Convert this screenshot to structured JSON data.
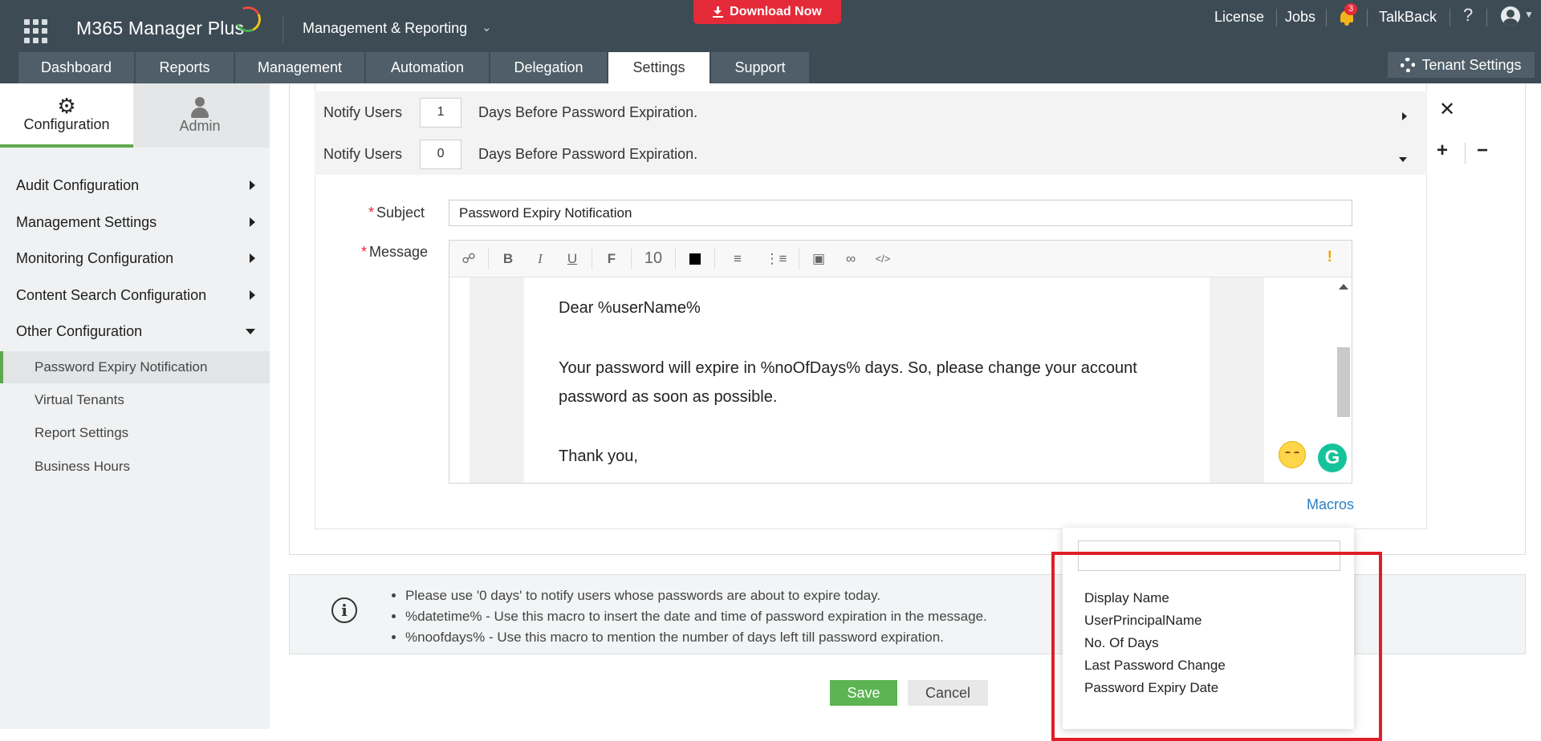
{
  "app": {
    "logo": "M365 Manager Plus",
    "module": "Management & Reporting",
    "download": "Download Now"
  },
  "topnav": {
    "license": "License",
    "jobs": "Jobs",
    "bell_count": "3",
    "talkback": "TalkBack",
    "help": "?"
  },
  "tabs": [
    "Dashboard",
    "Reports",
    "Management",
    "Automation",
    "Delegation",
    "Settings",
    "Support"
  ],
  "tenant_settings": "Tenant Settings",
  "sidebar": {
    "tabs": [
      "Configuration",
      "Admin"
    ],
    "sections": [
      "Audit Configuration",
      "Management Settings",
      "Monitoring Configuration",
      "Content Search Configuration",
      "Other Configuration"
    ],
    "sub_items": [
      "Password Expiry Notification",
      "Virtual Tenants",
      "Report Settings",
      "Business Hours"
    ]
  },
  "notify": [
    {
      "label": "Notify Users",
      "days": "1",
      "text": "Days Before Password Expiration."
    },
    {
      "label": "Notify Users",
      "days": "0",
      "text": "Days Before Password Expiration."
    }
  ],
  "form": {
    "subject_label": "Subject",
    "subject_value": "Password Expiry Notification",
    "message_label": "Message",
    "font_size": "10",
    "font_icon": "F",
    "body": [
      "Dear %userName%",
      "Your password will expire in %noOfDays% days. So, please change your account",
      "password as soon as possible.",
      "Thank you,"
    ],
    "macros": "Macros"
  },
  "info": [
    "Please use '0 days' to notify users whose passwords are about to expire today.",
    "%datetime% - Use this macro to insert the date and time of password expiration in the message.",
    "%noofdays% - Use this macro to mention the number of days left till password expiration."
  ],
  "buttons": {
    "save": "Save",
    "cancel": "Cancel"
  },
  "macros_menu": [
    "Display Name",
    "UserPrincipalName",
    "No. Of Days",
    "Last Password Change",
    "Password Expiry Date"
  ]
}
